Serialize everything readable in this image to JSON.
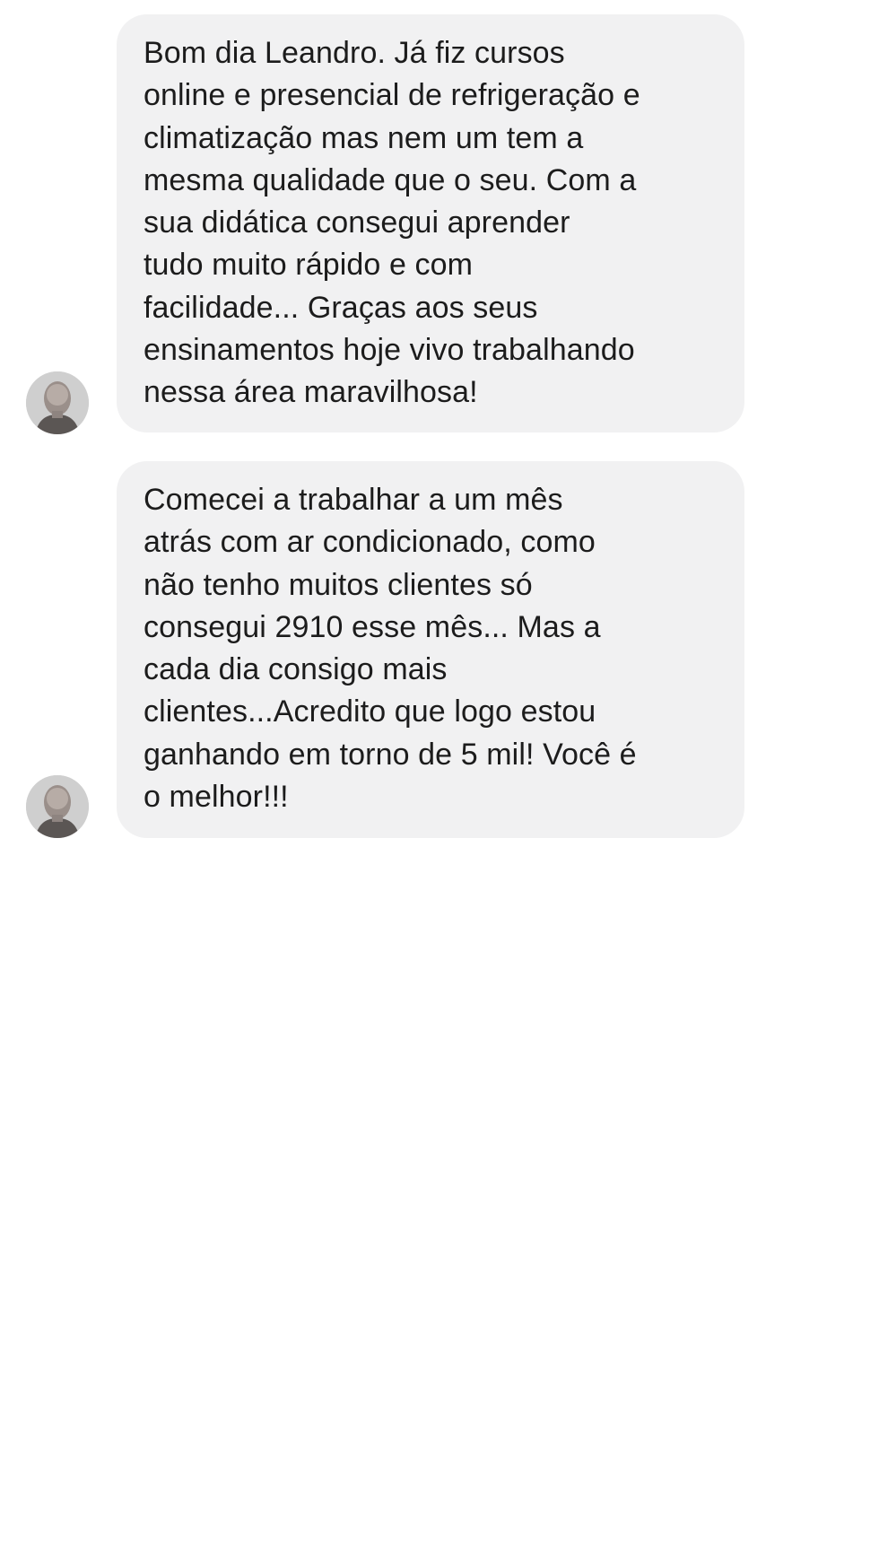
{
  "conversation": {
    "messages": [
      {
        "sender_avatar_icon": "user-avatar-icon",
        "text": "Bom dia Leandro. Já fiz cursos\nonline e presencial de refrigeração e\nclimatização mas nem um tem a\nmesma qualidade que o seu. Com a\nsua didática consegui aprender\ntudo muito rápido e com\nfacilidade... Graças aos seus\nensinamentos hoje vivo trabalhando\nnessa área maravilhosa!"
      },
      {
        "sender_avatar_icon": "user-avatar-icon",
        "text": "Comecei a trabalhar a um mês\natrás com ar condicionado, como\nnão tenho muitos clientes só\nconsegui 2910 esse mês... Mas a\ncada dia consigo mais\nclientes...Acredito que logo estou\nganhando em torno de 5 mil! Você é\no melhor!!!"
      }
    ]
  },
  "colors": {
    "background": "#ffffff",
    "bubble": "#f1f1f2",
    "text": "#1c1c1c"
  }
}
